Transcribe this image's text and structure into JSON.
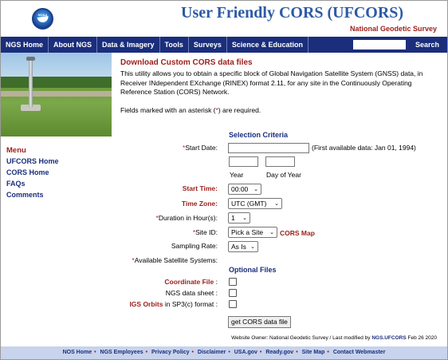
{
  "header": {
    "logo_text": "NOAA",
    "title": "User Friendly CORS (UFCORS)",
    "agency": "National Geodetic Survey"
  },
  "nav": {
    "items": [
      "NGS Home",
      "About NGS",
      "Data & Imagery",
      "Tools",
      "Surveys",
      "Science & Education"
    ],
    "search_value": "",
    "search_label": "Search"
  },
  "menu": {
    "heading": "Menu",
    "items": [
      "UFCORS Home",
      "CORS Home",
      "FAQs",
      "Comments"
    ]
  },
  "main": {
    "heading": "Download Custom CORS data files",
    "intro": "This utility allows you to obtain a specific block of Global Navigation Satellite System (GNSS) data, in Receiver INdependent EXchange (RINEX) format 2.11, for any site in the Continuously Operating Reference Station (CORS) Network.",
    "required_note_prefix": "Fields marked with an asterisk (",
    "required_note_asterisk": "*",
    "required_note_suffix": ") are required.",
    "selection_criteria": "Selection Criteria",
    "start_date_label": "Start Date:",
    "start_date_value": "",
    "first_available": "(First available data: Jan 01, 1994)",
    "year_label": "Year",
    "year_value": "",
    "day_label": "Day of Year",
    "day_value": "",
    "start_time_label": "Start Time:",
    "start_time_value": "00:00",
    "time_zone_label": "Time Zone:",
    "time_zone_value": "UTC (GMT)",
    "duration_label": "Duration in Hour(s):",
    "duration_value": "1",
    "site_id_label": "Site ID:",
    "site_id_value": "Pick a Site",
    "cors_map_link": "CORS Map",
    "sampling_label": "Sampling Rate:",
    "sampling_value": "As Is",
    "sat_systems_label": "Available Satellite Systems:",
    "optional_files": "Optional Files",
    "coord_file_label": "Coordinate File",
    "coord_file_suffix": ":",
    "ngs_sheet_label": "NGS data sheet :",
    "igs_orbits_label": "IGS Orbits",
    "igs_orbits_suffix": "in SP3(c) format :",
    "submit_label": "get CORS data file",
    "owner_text": "Website Owner: National Geodetic Survey  /  Last modified by",
    "owner_name": "NGS.UFCORS",
    "owner_date": "Feb 26 2020"
  },
  "footer": {
    "links": [
      "NOS Home",
      "NGS Employees",
      "Privacy Policy",
      "Disclaimer",
      "USA.gov",
      "Ready.gov",
      "Site Map",
      "Contact Webmaster"
    ]
  },
  "colors": {
    "nav_bg": "#1a2e7c",
    "title_blue": "#2e5aa6",
    "accent_red": "#9b1e1a",
    "footer_bg": "#c8d3ec"
  }
}
